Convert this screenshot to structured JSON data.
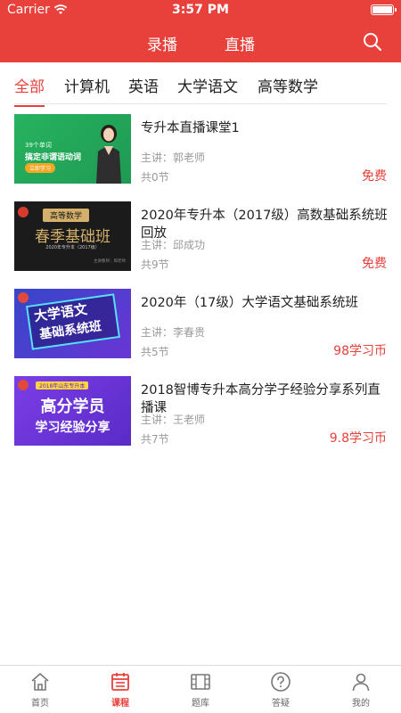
{
  "status": {
    "carrier": "Carrier",
    "time": "3:57 PM"
  },
  "topnav": {
    "tabs": [
      "录播",
      "直播"
    ],
    "active": 0,
    "search_icon": "search-icon"
  },
  "categories": {
    "items": [
      "全部",
      "计算机",
      "英语",
      "大学语文",
      "高等数学"
    ],
    "active": 0
  },
  "courses": [
    {
      "title": "专升本直播课堂1",
      "teacher": "主讲：郭老师",
      "lessons": "共0节",
      "price": "免费",
      "thumb": {
        "line1": "39个单词",
        "line2": "搞定非谓语动词",
        "button": "立即学习"
      }
    },
    {
      "title": "2020年专升本（2017级）高数基础系统班回放",
      "teacher": "主讲：邱成功",
      "lessons": "共9节",
      "price": "免费",
      "thumb": {
        "line1": "高等数学",
        "line2": "春季基础班",
        "line3": "2020年专升本（2017级）",
        "line4": "主讲教师：邱老师"
      }
    },
    {
      "title": "2020年（17级）大学语文基础系统班",
      "teacher": "主讲：李春贵",
      "lessons": "共5节",
      "price": "98学习币",
      "thumb": {
        "line1": "大学语文",
        "line2": "基础系统班"
      }
    },
    {
      "title": "2018智博专升本高分学子经验分享系列直播课",
      "teacher": "主讲：王老师",
      "lessons": "共7节",
      "price": "9.8学习币",
      "thumb": {
        "line1": "2018年山东专升本",
        "line2": "高分学员",
        "line3": "学习经验分享"
      }
    }
  ],
  "tabbar": {
    "items": [
      {
        "label": "首页",
        "icon": "home-icon"
      },
      {
        "label": "课程",
        "icon": "calendar-icon"
      },
      {
        "label": "题库",
        "icon": "film-icon"
      },
      {
        "label": "答疑",
        "icon": "question-icon"
      },
      {
        "label": "我的",
        "icon": "person-icon"
      }
    ],
    "active": 1
  },
  "colors": {
    "accent": "#e8403a",
    "text": "#222222",
    "muted": "#999999"
  }
}
